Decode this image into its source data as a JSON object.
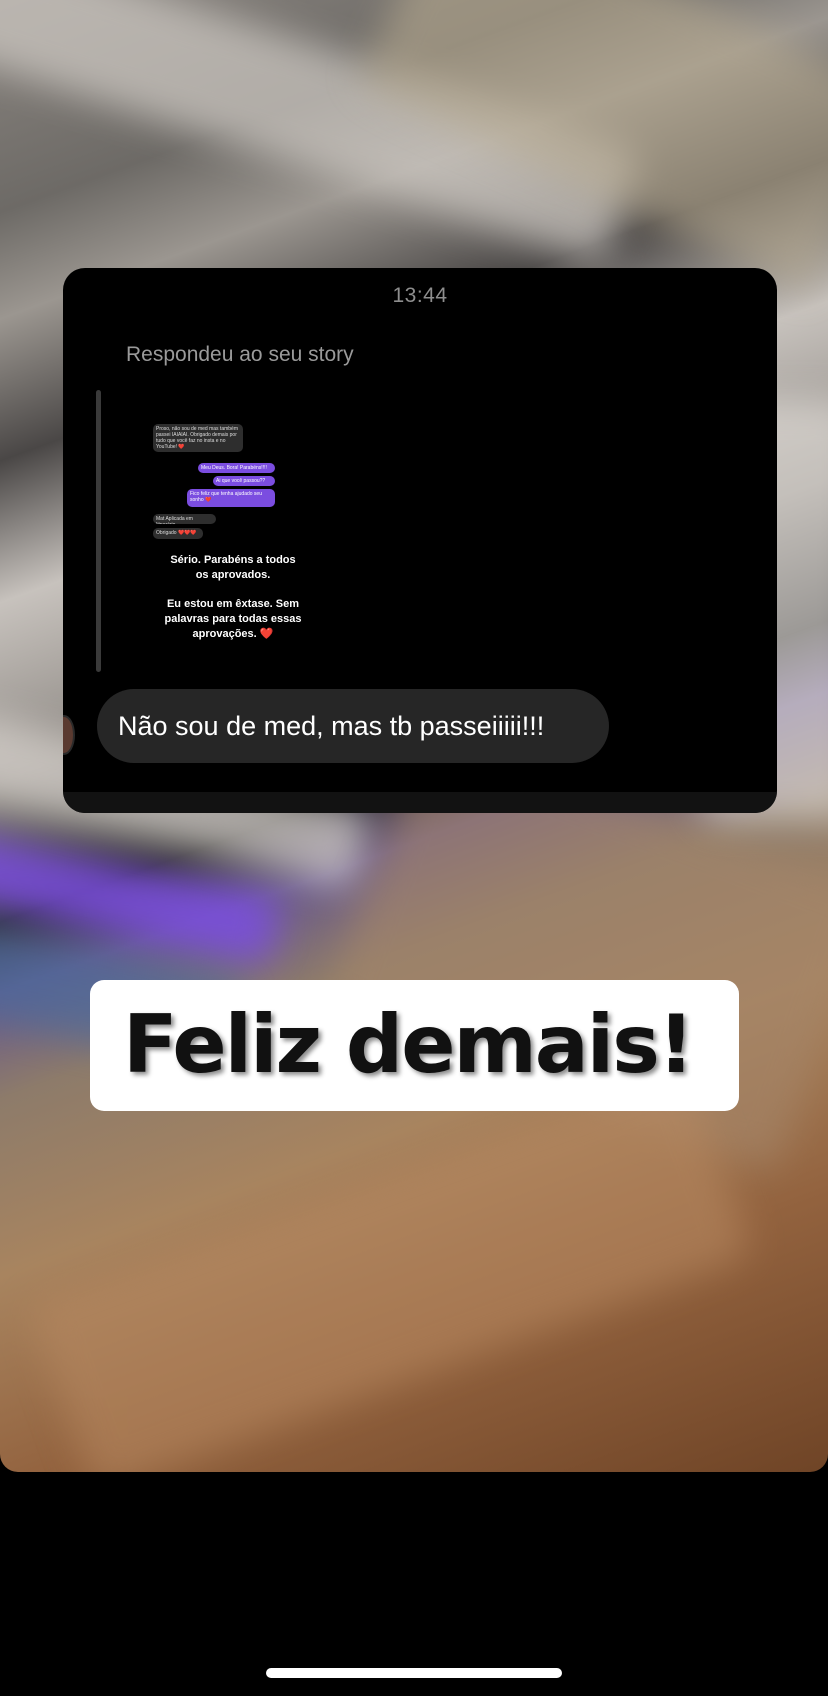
{
  "chat": {
    "time": "13:44",
    "reply_label": "Respondeu ao seu story",
    "message": "Não sou de med, mas tb passeiiiii!!!"
  },
  "story_thumbnail": {
    "mini_messages": [
      {
        "text": "Proso, não sou de med mas também passei IAIAIAI. Obrigado demais por tudo que você faz no insta e no YouTube! ❤️",
        "style": "gray"
      },
      {
        "text": "Meu Deus. Bora! Parabéns!!!!",
        "style": "purple"
      },
      {
        "text": "Ai que você passou??",
        "style": "purple"
      },
      {
        "text": "Fico feliz que tenha ajudado seu sonho ❤️",
        "style": "purple"
      },
      {
        "text": "Mat Aplicada em Itinerário",
        "style": "gray"
      },
      {
        "text": "Obrigado ❤️❤️❤️",
        "style": "gray"
      }
    ],
    "text_1": "Sério. Parabéns a todos os aprovados.",
    "text_2": "Eu estou em êxtase. Sem palavras para todas essas aprovações. ❤️"
  },
  "caption": "Feliz demais!",
  "colors": {
    "card_bg": "#000000",
    "bubble_bg": "#262626",
    "purple_bubble": "#7b4de0",
    "caption_bg": "#ffffff"
  }
}
